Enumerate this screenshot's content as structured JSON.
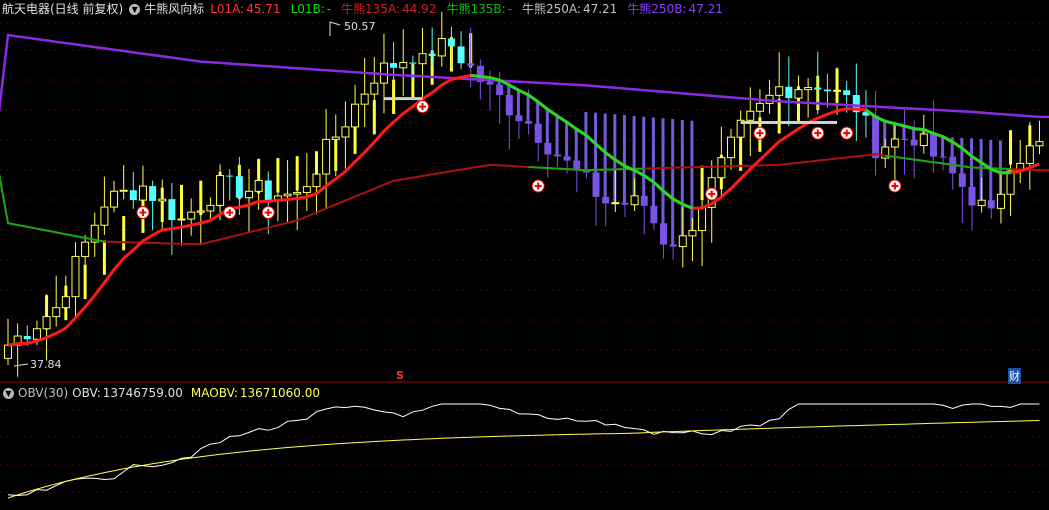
{
  "header": {
    "title": "航天电器(日线 前复权)",
    "indicator_name": "牛熊风向标",
    "items": [
      {
        "label": "L01A:",
        "value": "45.71",
        "color": "#ff3232"
      },
      {
        "label": "L01B:",
        "value": "-",
        "color": "#00e000"
      },
      {
        "label": "牛熊135A:",
        "value": "44.92",
        "color": "#d02020"
      },
      {
        "label": "牛熊135B:",
        "value": "-",
        "color": "#00c000"
      },
      {
        "label": "牛熊250A:",
        "value": "47.21",
        "color": "#c0c0c0"
      },
      {
        "label": "牛熊250B:",
        "value": "47.21",
        "color": "#8a3cff"
      }
    ]
  },
  "obv_header": {
    "name": "OBV(30)",
    "obv_label": "OBV:",
    "obv_value": "13746759.00",
    "maobv_label": "MAOBV:",
    "maobv_value": "13671060.00"
  },
  "markers": {
    "high_label": "50.57",
    "low_label": "37.84",
    "s_marker": "S",
    "cai_marker": "财"
  },
  "chart_data": [
    {
      "type": "candlestick",
      "name": "price",
      "count": 108,
      "high": 50.57,
      "low": 37.84,
      "last_values": {
        "L01A": 45.71,
        "niuxiong135A": 44.92,
        "niuxiong250A": 47.21,
        "niuxiong250B": 47.21
      },
      "colors": {
        "up": "#ffff55",
        "down": "#55ffff",
        "ma_short": "#ff1a1a",
        "ma_short_bull": "#22dd22",
        "ma_mid": "#aa1111",
        "ma_mid_bull": "#11aa11",
        "ma_long": "#8a2be2",
        "bar_up": "#ffff33",
        "bar_down": "#7b68ee"
      }
    },
    {
      "type": "line",
      "name": "OBV(30)",
      "series": [
        {
          "name": "OBV",
          "last": 13746759.0,
          "color": "#ffffff"
        },
        {
          "name": "MAOBV",
          "last": 13671060.0,
          "color": "#ffff55"
        }
      ]
    }
  ]
}
